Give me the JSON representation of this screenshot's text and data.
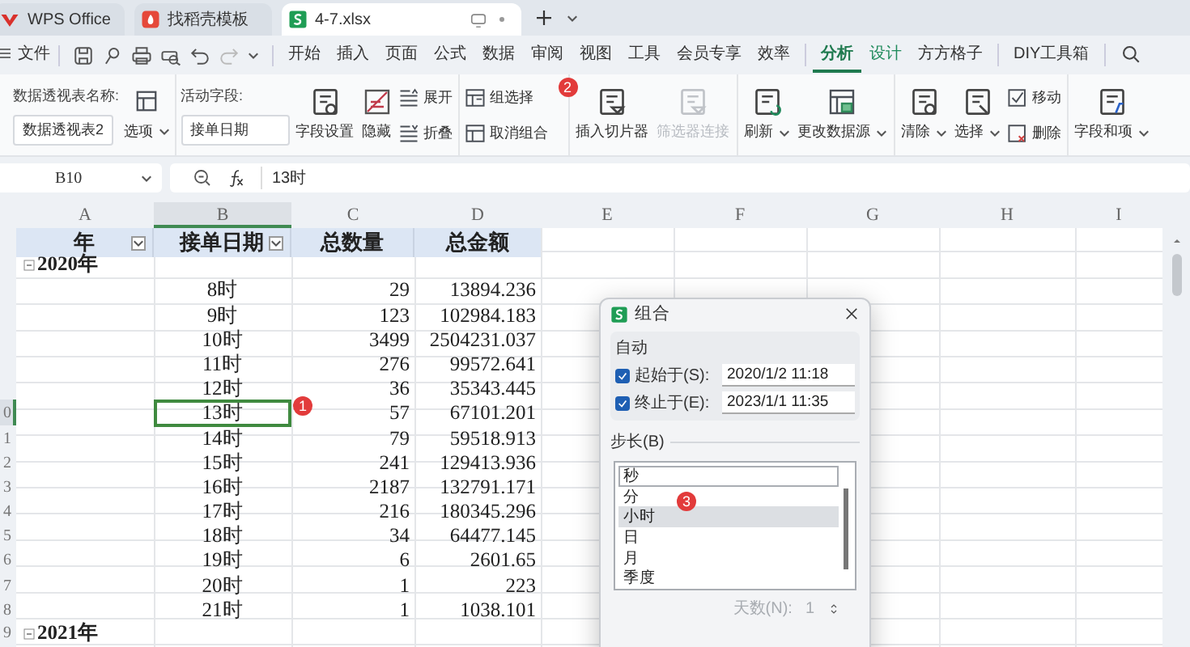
{
  "tabs": [
    {
      "kind": "home",
      "label": "WPS Office",
      "selected": false
    },
    {
      "kind": "template",
      "label": "找稻壳模板",
      "selected": false
    },
    {
      "kind": "sheet",
      "label": "4-7.xlsx",
      "selected": true
    }
  ],
  "menu": {
    "file": "文件",
    "tabs": [
      {
        "label": "开始",
        "selected": false,
        "contextual": false
      },
      {
        "label": "插入",
        "selected": false,
        "contextual": false
      },
      {
        "label": "页面",
        "selected": false,
        "contextual": false
      },
      {
        "label": "公式",
        "selected": false,
        "contextual": false
      },
      {
        "label": "数据",
        "selected": false,
        "contextual": false
      },
      {
        "label": "审阅",
        "selected": false,
        "contextual": false
      },
      {
        "label": "视图",
        "selected": false,
        "contextual": false
      },
      {
        "label": "工具",
        "selected": false,
        "contextual": false
      },
      {
        "label": "会员专享",
        "selected": false,
        "contextual": false
      },
      {
        "label": "效率",
        "selected": false,
        "contextual": false
      },
      {
        "label": "分析",
        "selected": true,
        "contextual": true
      },
      {
        "label": "设计",
        "selected": false,
        "contextual": true
      },
      {
        "label": "方方格子",
        "selected": false,
        "contextual": false
      },
      {
        "label": "DIY工具箱",
        "selected": false,
        "contextual": false
      }
    ]
  },
  "ribbon": {
    "pivot_name": {
      "label": "数据透视表名称:",
      "value": "数据透视表2"
    },
    "options": "选项",
    "active_field": {
      "label": "活动字段:",
      "value": "接单日期"
    },
    "field_settings": "字段设置",
    "hide": "隐藏",
    "expand": "展开",
    "collapse": "折叠",
    "group_selection": {
      "label": "组选择",
      "badge": "2"
    },
    "ungroup": "取消组合",
    "insert_slicer": {
      "label": "插入切片器",
      "disabled": false
    },
    "filter_connections": {
      "label": "筛选器连接",
      "disabled": true
    },
    "refresh": "刷新",
    "change_source": "更改数据源",
    "clear": "清除",
    "select": "选择",
    "move": "移动",
    "delete": "删除",
    "fields_items": "字段和项"
  },
  "formula_bar": {
    "name_box": "B10",
    "content": "13时"
  },
  "sheet": {
    "columns": [
      {
        "label": "A",
        "selected": false
      },
      {
        "label": "B",
        "selected": true
      },
      {
        "label": "C",
        "selected": false
      },
      {
        "label": "D",
        "selected": false
      },
      {
        "label": "E",
        "selected": false
      },
      {
        "label": "F",
        "selected": false
      },
      {
        "label": "G",
        "selected": false
      },
      {
        "label": "H",
        "selected": false
      },
      {
        "label": "I",
        "selected": false
      }
    ],
    "rows": [
      {
        "kind": "header",
        "cells": [
          "年",
          "接单日期",
          "总数量",
          "总金额"
        ]
      },
      {
        "kind": "group",
        "label": "2020年",
        "expanded": true
      },
      {
        "kind": "item",
        "hour": "8时",
        "quantity": "29",
        "amount": "13894.236",
        "selected": false
      },
      {
        "kind": "item",
        "hour": "9时",
        "quantity": "123",
        "amount": "102984.183",
        "selected": false
      },
      {
        "kind": "item",
        "hour": "10时",
        "quantity": "3499",
        "amount": "2504231.037",
        "selected": false
      },
      {
        "kind": "item",
        "hour": "11时",
        "quantity": "276",
        "amount": "99572.641",
        "selected": false
      },
      {
        "kind": "item",
        "hour": "12时",
        "quantity": "36",
        "amount": "35343.445",
        "selected": false
      },
      {
        "kind": "item",
        "hour": "13时",
        "quantity": "57",
        "amount": "67101.201",
        "selected": true,
        "row_number": "0",
        "badge": "1"
      },
      {
        "kind": "item",
        "hour": "14时",
        "quantity": "79",
        "amount": "59518.913",
        "selected": false,
        "row_number": "1"
      },
      {
        "kind": "item",
        "hour": "15时",
        "quantity": "241",
        "amount": "129413.936",
        "selected": false,
        "row_number": "2"
      },
      {
        "kind": "item",
        "hour": "16时",
        "quantity": "2187",
        "amount": "132791.171",
        "selected": false,
        "row_number": "3"
      },
      {
        "kind": "item",
        "hour": "17时",
        "quantity": "216",
        "amount": "180345.296",
        "selected": false,
        "row_number": "4"
      },
      {
        "kind": "item",
        "hour": "18时",
        "quantity": "34",
        "amount": "64477.145",
        "selected": false,
        "row_number": "5"
      },
      {
        "kind": "item",
        "hour": "19时",
        "quantity": "6",
        "amount": "2601.65",
        "selected": false,
        "row_number": "6"
      },
      {
        "kind": "item",
        "hour": "20时",
        "quantity": "1",
        "amount": "223",
        "selected": false,
        "row_number": "7"
      },
      {
        "kind": "item",
        "hour": "21时",
        "quantity": "1",
        "amount": "1038.101",
        "selected": false,
        "row_number": "8"
      },
      {
        "kind": "group",
        "label": "2021年",
        "expanded": true,
        "row_number": "9"
      }
    ]
  },
  "dialog": {
    "title": "组合",
    "auto_label": "自动",
    "start": {
      "label": "起始于(S):",
      "checked": true,
      "value": "2020/1/2 11:18"
    },
    "end": {
      "label": "终止于(E):",
      "checked": true,
      "value": "2023/1/1 11:35"
    },
    "step_label": "步长(B)",
    "step_options": [
      {
        "label": "秒",
        "selected": false,
        "focused": true
      },
      {
        "label": "分",
        "selected": false,
        "focused": false
      },
      {
        "label": "小时",
        "selected": true,
        "focused": false
      },
      {
        "label": "日",
        "selected": false,
        "focused": false
      },
      {
        "label": "月",
        "selected": false,
        "focused": false
      },
      {
        "label": "季度",
        "selected": false,
        "focused": false
      }
    ],
    "badge": "3",
    "days": {
      "label": "天数(N):",
      "value": "1",
      "disabled": true
    }
  }
}
